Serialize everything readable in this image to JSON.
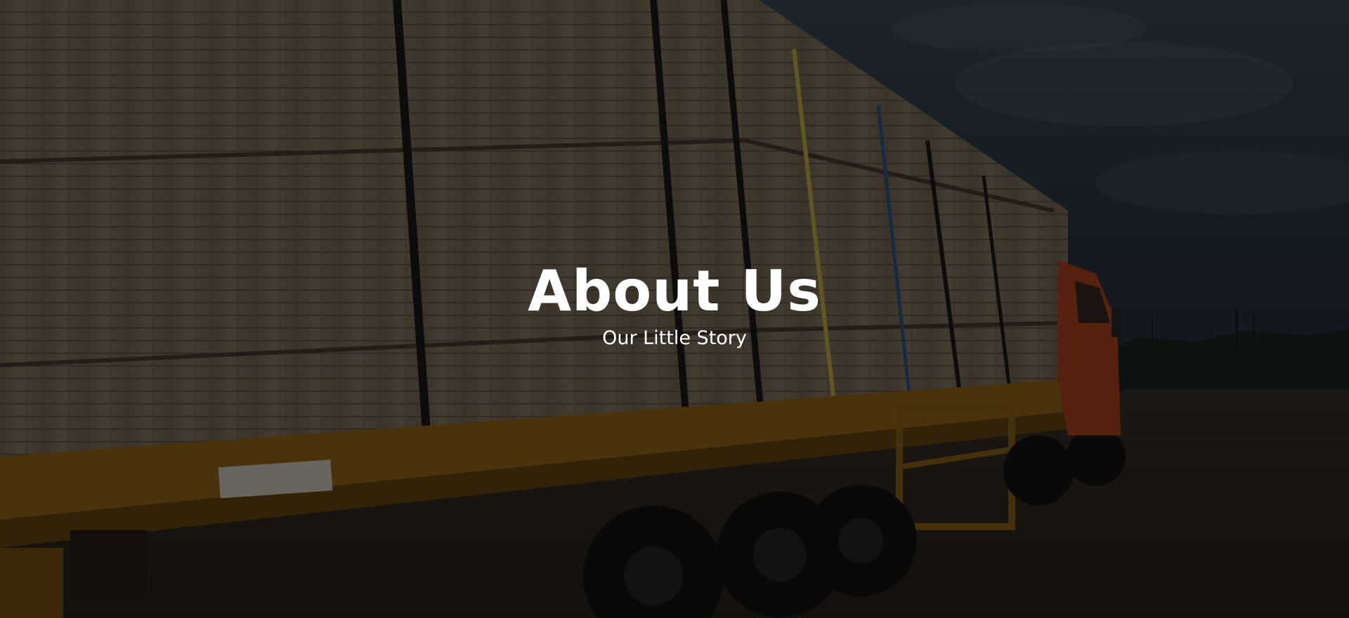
{
  "hero": {
    "title": "About Us",
    "subtitle": "Our Little Story",
    "background_image": "timber-truck-photo",
    "overlay_color": "#000000",
    "text_color": "#ffffff"
  }
}
